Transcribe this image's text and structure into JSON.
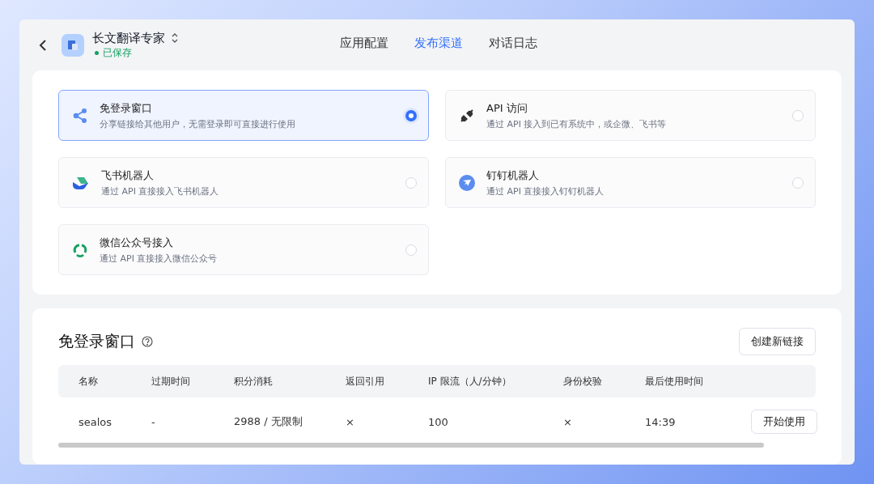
{
  "header": {
    "app_name": "长文翻译专家",
    "status": "已保存",
    "tabs": [
      {
        "label": "应用配置",
        "selected": false
      },
      {
        "label": "发布渠道",
        "selected": true
      },
      {
        "label": "对话日志",
        "selected": false
      }
    ]
  },
  "channels": [
    {
      "kind": "share",
      "title": "免登录窗口",
      "description": "分享链接给其他用户，无需登录即可直接进行使用",
      "selected": true
    },
    {
      "kind": "plug",
      "title": "API 访问",
      "description": "通过 API 接入到已有系统中，或企微、飞书等",
      "selected": false
    },
    {
      "kind": "feishu",
      "title": "飞书机器人",
      "description": "通过 API 直接接入飞书机器人",
      "selected": false
    },
    {
      "kind": "dingtalk",
      "title": "钉钉机器人",
      "description": "通过 API 直接接入钉钉机器人",
      "selected": false
    },
    {
      "kind": "wechat",
      "title": "微信公众号接入",
      "description": "通过 API 直接接入微信公众号",
      "selected": false
    }
  ],
  "links": {
    "title": "免登录窗口",
    "create_button": "创建新链接",
    "table": {
      "columns": [
        "名称",
        "过期时间",
        "积分消耗",
        "返回引用",
        "IP 限流（人/分钟）",
        "身份校验",
        "最后使用时间"
      ],
      "rows": [
        {
          "cells": [
            "sealos",
            "-",
            "2988 / 无限制",
            "×",
            "100",
            "×",
            "14:39"
          ],
          "action": "开始使用"
        }
      ]
    }
  }
}
